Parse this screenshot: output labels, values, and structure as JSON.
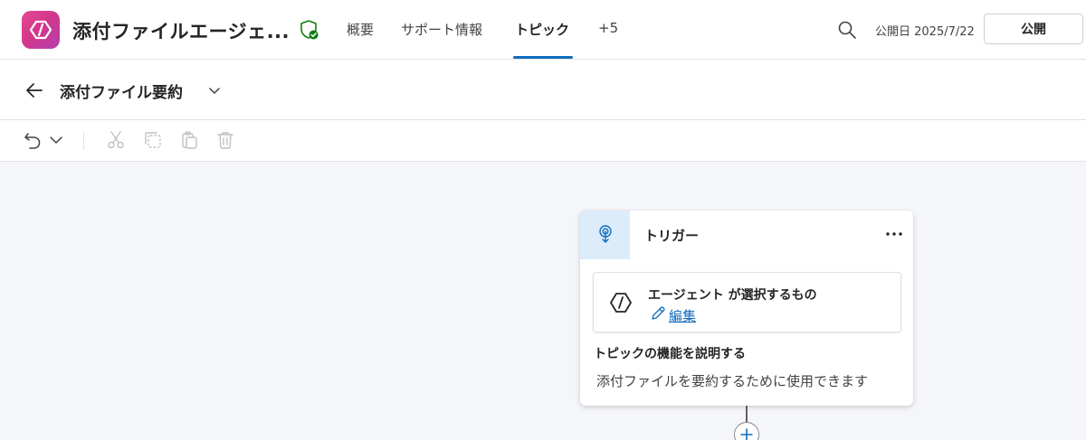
{
  "header": {
    "app_title": "添付ファイルエージェ...",
    "tabs": [
      {
        "label": "概要"
      },
      {
        "label": "サポート情報"
      },
      {
        "label": "トピック"
      },
      {
        "label": "+5"
      }
    ],
    "published_date": "公開日 2025/7/22",
    "publish_label": "公開"
  },
  "subheader": {
    "topic_title": "添付ファイル要約"
  },
  "toolbar": {
    "icons": [
      "undo-icon",
      "chevron-down-icon",
      "cut-icon",
      "copy-icon",
      "paste-icon",
      "delete-icon"
    ]
  },
  "trigger_card": {
    "title": "トリガー",
    "agent_label": "エージェント が選択するもの",
    "edit_label": "編集",
    "description_heading": "トピックの機能を説明する",
    "description_text": "添付ファイルを要約するために使用できます"
  },
  "colors": {
    "accent": "#0f6cbd",
    "canvas_bg": "#f5f6fa",
    "logo_gradient_start": "#e6478f",
    "logo_gradient_end": "#b33fb0",
    "shield_green": "#107c10",
    "trigger_icon_bg": "#dcecfb"
  }
}
